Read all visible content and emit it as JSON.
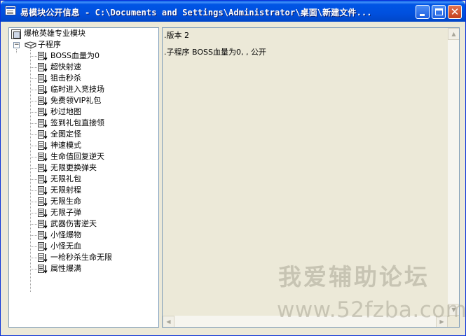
{
  "window": {
    "title": "易模块公开信息 - C:\\Documents and Settings\\Administrator\\桌面\\新建文件...",
    "minimize_icon": "minimize-icon",
    "maximize_icon": "maximize-icon",
    "close_icon": "close-icon",
    "close_glyph": "✕"
  },
  "tree": {
    "root_label": "爆枪英雄专业模块",
    "group_label": "子程序",
    "group_expander": "−",
    "items": [
      "BOSS血量为0",
      "超快射速",
      "狙击秒杀",
      "临时进入竞技场",
      "免费领VIP礼包",
      "秒过地图",
      "签到礼包直接领",
      "全图定怪",
      "神速模式",
      "生命值回复逆天",
      "无限更换弹夹",
      "无限礼包",
      "无限射程",
      "无限生命",
      "无限子弹",
      "武器伤害逆天",
      "小怪爆物",
      "小怪无血",
      "一枪秒杀生命无限",
      "属性爆满"
    ]
  },
  "code": {
    "lines": [
      ".版本 2",
      ".子程序 BOSS血量为0, , 公开"
    ]
  },
  "scrollbars": {
    "up_arrow": "▲",
    "down_arrow": "▼",
    "left_arrow": "◀",
    "right_arrow": "▶"
  },
  "watermark": {
    "line1": "我爱辅助论坛",
    "line2": "www.52fzba.com"
  },
  "colors": {
    "titlebar": "#0055e5",
    "panel_border": "#7f9db9",
    "window_bg": "#ece9d8"
  }
}
